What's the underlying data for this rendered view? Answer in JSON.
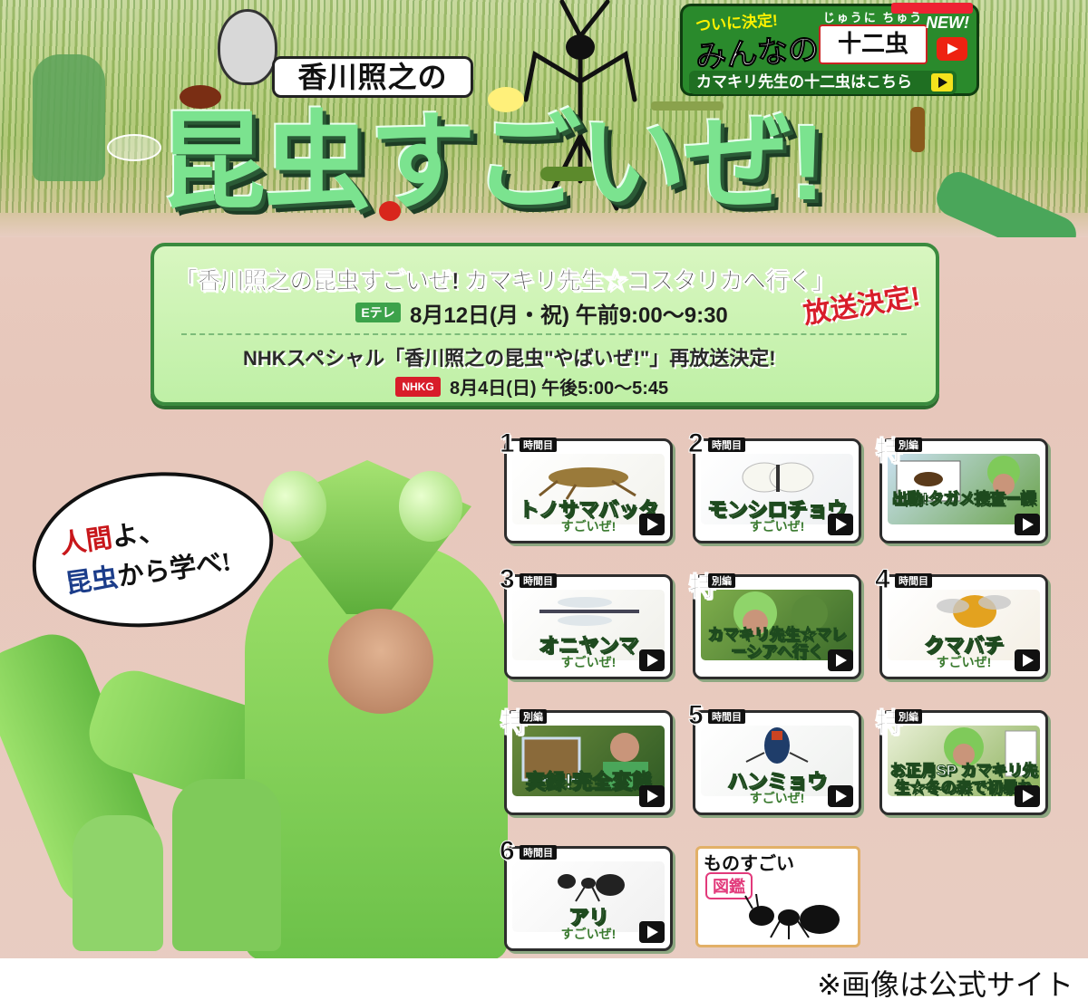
{
  "header": {
    "title_top": "香川照之の",
    "title_main": "昆虫すごいぜ!"
  },
  "banner": {
    "small_text": "ついに決定!",
    "big_text": "みんなの",
    "ruby": "じゅうに ちゅう",
    "logo_text": "十二虫",
    "new_label": "NEW!",
    "link_label": "カマキリ先生の十二虫はこちら"
  },
  "info": {
    "program_title": "「香川照之の昆虫すごいぜ! カマキリ先生☆コスタリカへ行く」",
    "channel1": "Eテレ",
    "airtime1": "8月12日(月・祝) 午前9:00～9:30",
    "announce1": "放送決定!",
    "program2": "NHKスペシャル「香川照之の昆虫\"やばいぜ!\"」再放送決定!",
    "channel2": "NHKG",
    "airtime2": "8月4日(日) 午後5:00～5:45"
  },
  "hero": {
    "bubble_line1_red": "人間",
    "bubble_line1_rest": "よ、",
    "bubble_line2_blue": "昆虫",
    "bubble_line2_rest": "から学べ!"
  },
  "episodes": [
    {
      "num": "1",
      "tag": "時間目",
      "name": "トノサマバッタ",
      "sub": "すごいぜ!",
      "photo": "grasshopper"
    },
    {
      "num": "2",
      "tag": "時間目",
      "name": "モンシロチョウ",
      "sub": "すごいぜ!",
      "photo": "butterfly"
    },
    {
      "num": "特",
      "tag": "別編",
      "name": "出動!タガメ捜査一課",
      "sub": "",
      "photo": "tagame"
    },
    {
      "num": "3",
      "tag": "時間目",
      "name": "オニヤンマ",
      "sub": "すごいぜ!",
      "photo": "dragonfly"
    },
    {
      "num": "特",
      "tag": "別編",
      "name": "カマキリ先生☆マレーシアへ行く",
      "sub": "",
      "photo": "malaysia"
    },
    {
      "num": "4",
      "tag": "時間目",
      "name": "クマバチ",
      "sub": "すごいぜ!",
      "photo": "bee"
    },
    {
      "num": "特",
      "tag": "別編",
      "name": "実録!完全変態",
      "sub": "",
      "photo": "metamorph"
    },
    {
      "num": "5",
      "tag": "時間目",
      "name": "ハンミョウ",
      "sub": "すごいぜ!",
      "photo": "tigerbeetle"
    },
    {
      "num": "特",
      "tag": "別編",
      "name": "お正月SP カマキリ先生☆冬の森で初暴れ",
      "sub": "",
      "photo": "newyear"
    },
    {
      "num": "6",
      "tag": "時間目",
      "name": "アリ",
      "sub": "すごいぜ!",
      "photo": "ant"
    }
  ],
  "zukan": {
    "line1": "ものすごい",
    "line2": "図鑑"
  },
  "footer": {
    "credit": "※画像は公式サイト"
  },
  "colors": {
    "accent_green": "#7be38f",
    "box_green": "#bff0a6",
    "announce_red": "#d81d2a",
    "background_pink": "#e7c7bb"
  }
}
